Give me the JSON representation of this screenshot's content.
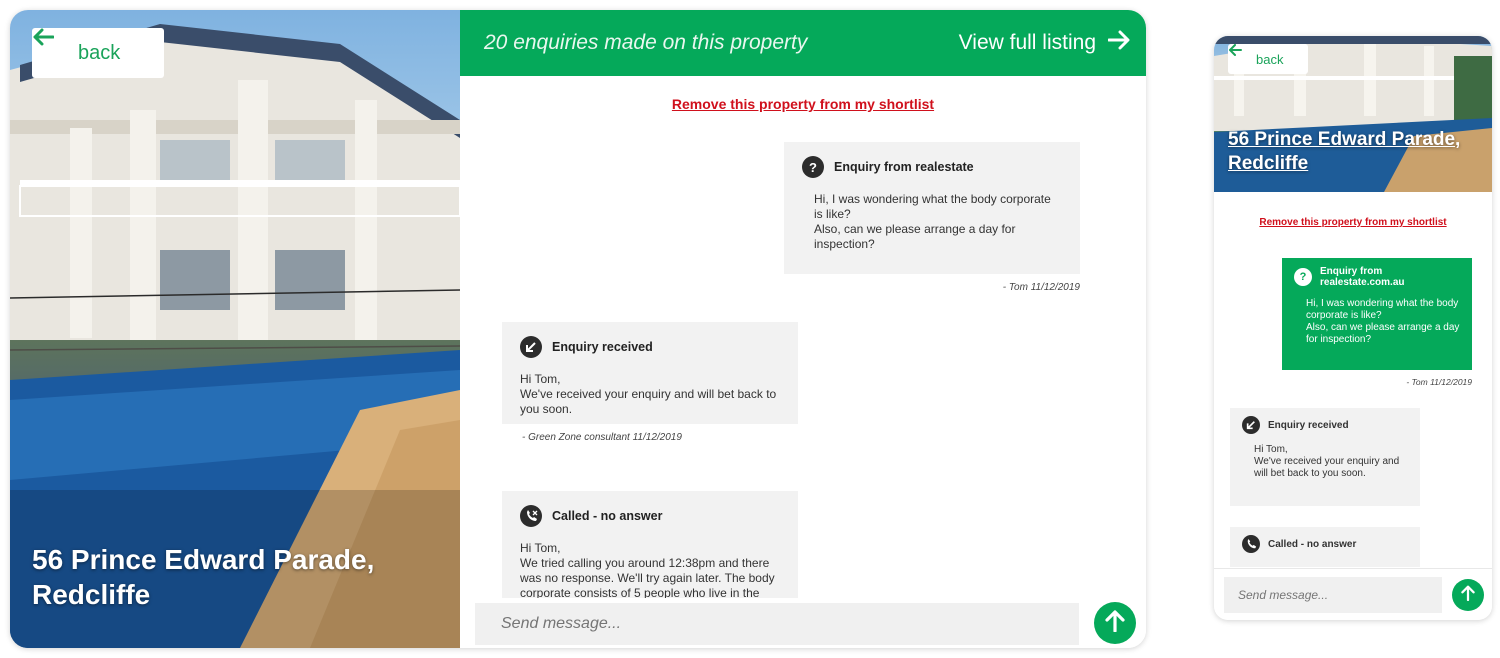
{
  "colors": {
    "brand_green": "#05a95a",
    "link_red": "#d0101c",
    "bubble_grey": "#f2f2f2"
  },
  "desktop": {
    "back_label": "back",
    "address": "56 Prince Edward Parade, Redcliffe",
    "enquiries_text": "20 enquiries made on this property",
    "view_listing_label": "View full listing",
    "remove_label": "Remove this property from my shortlist",
    "messages": [
      {
        "icon": "question-icon",
        "title": "Enquiry from realestate",
        "body": "Hi, I was wondering what the body corporate is like?\nAlso, can we please arrange a day for inspection?",
        "meta": "- Tom 11/12/2019"
      },
      {
        "icon": "arrow-down-left-icon",
        "title": "Enquiry received",
        "body": "Hi Tom,\nWe've received your enquiry and will bet back to you soon.",
        "meta": "- Green Zone consultant 11/12/2019"
      },
      {
        "icon": "phone-missed-icon",
        "title": "Called - no answer",
        "body": "Hi Tom,\nWe tried calling you around 12:38pm and there was no response. We'll try again later. The body corporate consists of 5 people who live in the"
      }
    ],
    "composer_placeholder": "Send message..."
  },
  "mobile": {
    "back_label": "back",
    "address": "56 Prince Edward Parade, Redcliffe",
    "remove_label": "Remove this property from my shortlist",
    "messages": [
      {
        "title": "Enquiry from realestate.com.au",
        "body": "Hi, I was wondering what the body corporate is like?\nAlso, can we please arrange a day for inspection?",
        "meta": "- Tom 11/12/2019"
      },
      {
        "title": "Enquiry received",
        "body": "Hi Tom,\nWe've received your enquiry and will bet back to you soon."
      },
      {
        "title": "Called - no answer"
      }
    ],
    "composer_placeholder": "Send message..."
  }
}
